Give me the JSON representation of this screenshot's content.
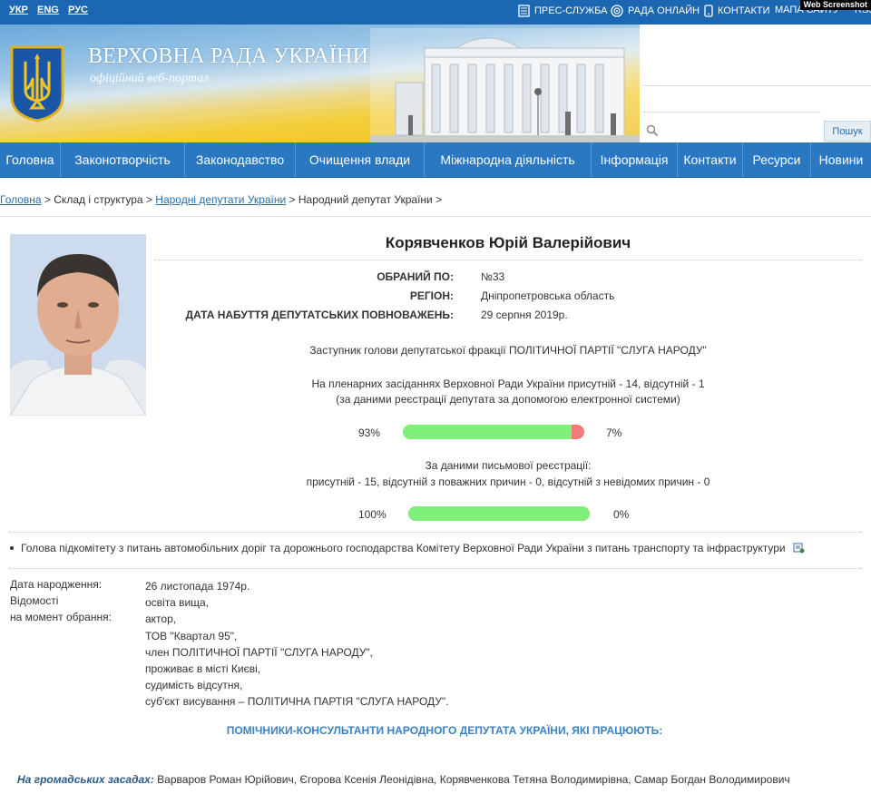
{
  "topbar": {
    "langs": [
      "УКР",
      "ENG",
      "РУС"
    ],
    "links": [
      "ПРЕС-СЛУЖБА",
      "РАДА ОНЛАЙН",
      "КОНТАКТИ",
      "МАПА САЙТУ",
      "RSS"
    ],
    "watermark": "Web Screenshot",
    "icons": [
      "newspaper-icon",
      "broadcast-icon",
      "phone-icon"
    ]
  },
  "header": {
    "title": "ВЕРХОВНА РАДА УКРАЇНИ",
    "subtitle": "офіційний веб-портал",
    "search_button": "Пошук",
    "search_placeholder": ""
  },
  "nav": {
    "items": [
      "Головна",
      "Законотворчість",
      "Законодавство",
      "Очищення влади",
      "Міжнародна діяльність",
      "Інформація",
      "Контакти",
      "Ресурси",
      "Новини"
    ]
  },
  "breadcrumb": {
    "home": "Головна",
    "sep1": " > Склад і структура > ",
    "deputies": "Народні депутати України",
    "sep2": " > Народний депутат України >"
  },
  "deputy": {
    "name": "Корявченков Юрій Валерійович",
    "info": [
      {
        "label": "ОБРАНИЙ ПО:",
        "value": "№33"
      },
      {
        "label": "РЕГІОН:",
        "value": "Дніпропетровська область"
      },
      {
        "label": "ДАТА НАБУТТЯ ДЕПУТАТСЬКИХ ПОВНОВАЖЕНЬ:",
        "value": "29 серпня 2019р."
      }
    ],
    "position": "Заступник голови депутатської фракції ПОЛІТИЧНОЇ ПАРТІЇ \"СЛУГА НАРОДУ\"",
    "electronic": {
      "line1": "На пленарних засіданнях Верховної Ради України присутній - 14, відсутній - 1",
      "line2": "(за даними реєстрації депутата за допомогою електронної системи)",
      "present_pct": "93%",
      "absent_pct": "7%",
      "present_fraction": 0.93
    },
    "written": {
      "line1": "За даними письмової реєстрації:",
      "line2": "присутній - 15, відсутній з поважних причин - 0, відсутній з невідомих причин - 0",
      "present_pct": "100%",
      "absent_pct": "0%",
      "present_fraction": 1.0
    },
    "committee": "Голова підкомітету з питань автомобільних доріг та дорожнього господарства Комітету Верховної Ради України з питань транспорту та інфраструктури",
    "birth_label": "Дата народження:",
    "birth_value": "26 листопада 1974р.",
    "bio_label_1": "Відомості",
    "bio_label_2": "на момент обрання:",
    "bio_lines": [
      "освіта вища,",
      "актор,",
      "ТОВ \"Квартал 95\",",
      "член ПОЛІТИЧНОЇ ПАРТІЇ \"СЛУГА НАРОДУ\",",
      "проживає в місті Києві,",
      "судимість відсутня,",
      "суб'єкт висування – ПОЛІТИЧНА ПАРТІЯ \"СЛУГА НАРОДУ\"."
    ],
    "assistants_title": "ПОМІЧНИКИ-КОНСУЛЬТАНТИ НАРОДНОГО ДЕПУТАТА УКРАЇНИ, ЯКІ ПРАЦЮЮТЬ:",
    "assistants_label": "На громадських засадах:",
    "assistants_names": " Варваров Роман Юрійович, Єгорова Ксенія Леонідівна, Корявченкова Тетяна Володимирівна, Самар Богдан Володимирович"
  },
  "colors": {
    "topbar": "#1c67b2",
    "nav": "#2a77c2",
    "bar_present": "#7ef07a",
    "bar_absent": "#f27a7a",
    "assistants_title": "#3b82c4"
  }
}
